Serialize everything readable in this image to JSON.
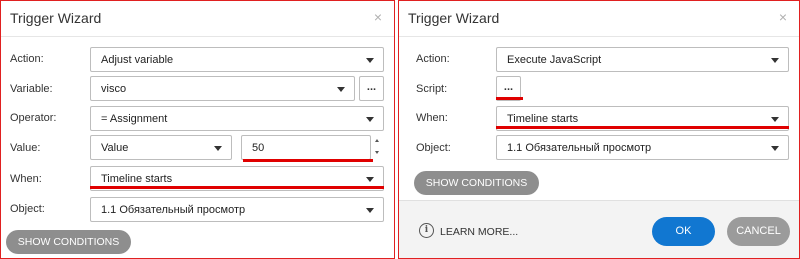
{
  "left_panel": {
    "title": "Trigger Wizard",
    "close_glyph": "×",
    "action": {
      "label": "Action:",
      "value": "Adjust variable"
    },
    "variable": {
      "label": "Variable:",
      "value": "visco",
      "button": "..."
    },
    "operator": {
      "label": "Operator:",
      "value": "= Assignment"
    },
    "value_row": {
      "label": "Value:",
      "type_value": "Value",
      "input_value": "50"
    },
    "when": {
      "label": "When:",
      "value": "Timeline starts"
    },
    "object": {
      "label": "Object:",
      "value": "1.1 Обязательный просмотр"
    },
    "show_conditions": "SHOW CONDITIONS"
  },
  "right_panel": {
    "title": "Trigger Wizard",
    "close_glyph": "×",
    "action": {
      "label": "Action:",
      "value": "Execute JavaScript"
    },
    "script": {
      "label": "Script:",
      "button": "..."
    },
    "when": {
      "label": "When:",
      "value": "Timeline starts"
    },
    "object": {
      "label": "Object:",
      "value": "1.1 Обязательный просмотр"
    },
    "show_conditions": "SHOW CONDITIONS",
    "footer": {
      "info_glyph": "i",
      "learn_more": "LEARN MORE...",
      "ok": "OK",
      "cancel": "CANCEL"
    }
  },
  "colors": {
    "highlight_red": "#e00000",
    "primary_blue": "#1177d1",
    "pill_gray": "#8e8e8e"
  }
}
